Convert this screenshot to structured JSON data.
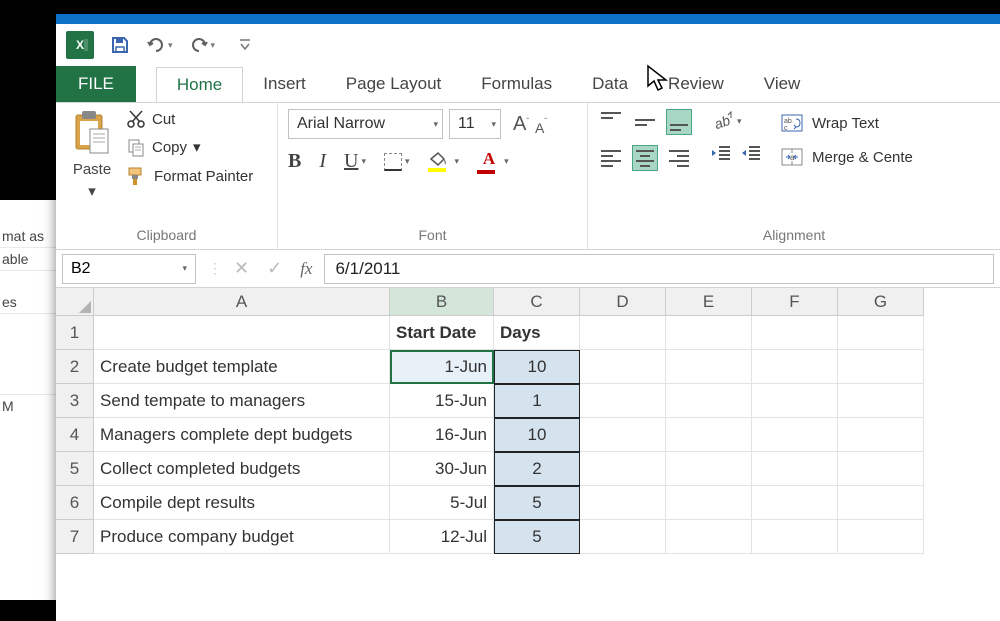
{
  "backdrop": {
    "format_as": "mat as",
    "table": "able",
    "es": "es",
    "m": "M"
  },
  "qat": {
    "undo_tip": "Undo",
    "redo_tip": "Redo"
  },
  "tabs": {
    "file": "FILE",
    "home": "Home",
    "insert": "Insert",
    "page_layout": "Page Layout",
    "formulas": "Formulas",
    "data": "Data",
    "review": "Review",
    "view": "View"
  },
  "ribbon": {
    "clipboard": {
      "paste": "Paste",
      "cut": "Cut",
      "copy": "Copy",
      "format_painter": "Format Painter",
      "label": "Clipboard"
    },
    "font": {
      "name": "Arial Narrow",
      "size": "11",
      "bold": "B",
      "italic": "I",
      "underline": "U",
      "font_color_letter": "A",
      "label": "Font"
    },
    "alignment": {
      "wrap": "Wrap Text",
      "merge": "Merge & Cente",
      "label": "Alignment"
    }
  },
  "formula_bar": {
    "name_box": "B2",
    "formula": "6/1/2011"
  },
  "grid": {
    "columns": [
      "A",
      "B",
      "C",
      "D",
      "E",
      "F",
      "G"
    ],
    "header_row": {
      "b": "Start Date",
      "c": "Days"
    },
    "rows": [
      {
        "num": "1",
        "a": "",
        "b": "Start Date",
        "c": "Days",
        "header": true
      },
      {
        "num": "2",
        "a": "Create budget template",
        "b": "1-Jun",
        "c": "10"
      },
      {
        "num": "3",
        "a": "Send tempate to managers",
        "b": "15-Jun",
        "c": "1"
      },
      {
        "num": "4",
        "a": "Managers complete dept budgets",
        "b": "16-Jun",
        "c": "10"
      },
      {
        "num": "5",
        "a": "Collect completed budgets",
        "b": "30-Jun",
        "c": "2"
      },
      {
        "num": "6",
        "a": "Compile dept results",
        "b": "5-Jul",
        "c": "5"
      },
      {
        "num": "7",
        "a": "Produce company budget",
        "b": "12-Jul",
        "c": "5"
      }
    ]
  }
}
